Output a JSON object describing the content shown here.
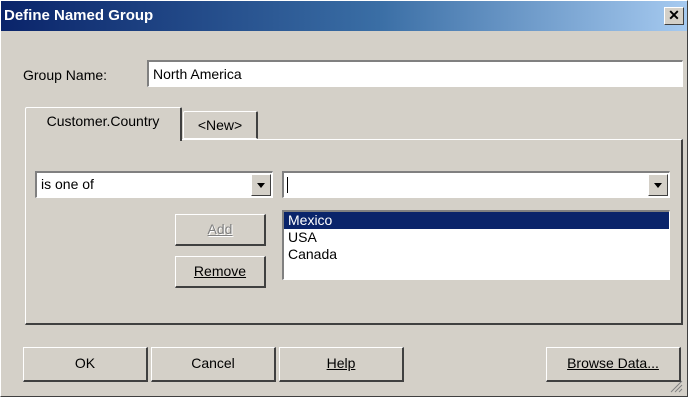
{
  "window": {
    "title": "Define Named Group",
    "close_glyph": "✕"
  },
  "group_name": {
    "label": "Group Name:",
    "value": "North America"
  },
  "tabs": [
    {
      "label": "Customer.Country",
      "active": true
    },
    {
      "label": "<New>",
      "active": false
    }
  ],
  "condition": {
    "operator_value": "is one of",
    "value_input": ""
  },
  "buttons": {
    "add_label": "Add",
    "remove_label": "Remove",
    "ok_label": "OK",
    "cancel_label": "Cancel",
    "help_label": "Help",
    "browse_label": "Browse Data..."
  },
  "values_list": [
    {
      "label": "Mexico",
      "selected": true
    },
    {
      "label": "USA",
      "selected": false
    },
    {
      "label": "Canada",
      "selected": false
    }
  ],
  "colors": {
    "face": "#d4d0c8",
    "title_start": "#0a246a",
    "selection": "#0a246a"
  }
}
